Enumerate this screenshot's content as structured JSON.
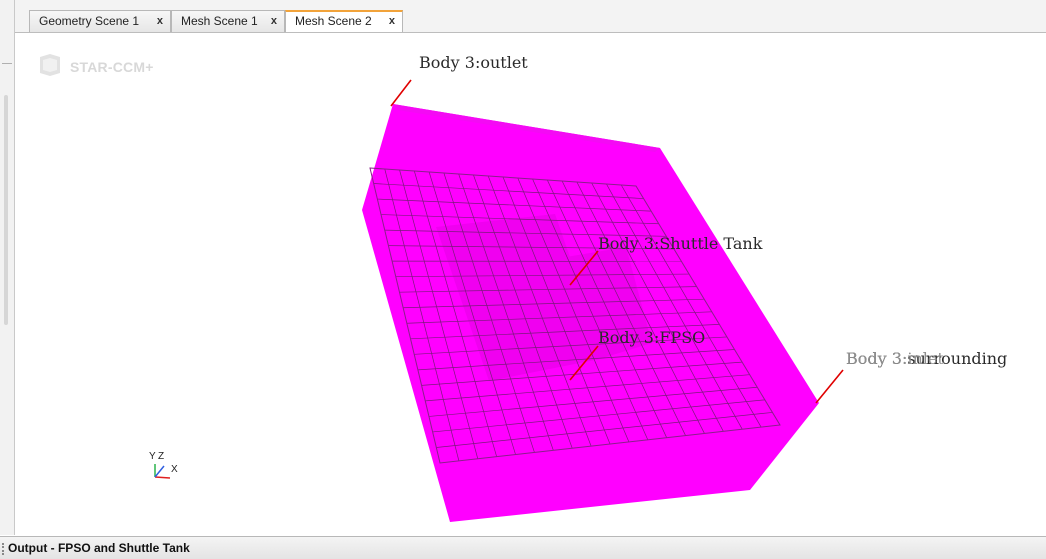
{
  "tabs": [
    {
      "label": "Geometry Scene 1",
      "close": "x",
      "active": false
    },
    {
      "label": "Mesh Scene 1",
      "close": "x",
      "active": false
    },
    {
      "label": "Mesh Scene 2",
      "close": "x",
      "active": true
    }
  ],
  "logo": {
    "text": "STAR-CCM+"
  },
  "scene": {
    "body_color": "#ff00ff",
    "mesh_color": "#7a1a7a",
    "leader_color": "#e00000",
    "labels": {
      "outlet": "Body 3:outlet",
      "shuttle_tank": "Body 3:Shuttle Tank",
      "fpso": "Body 3:FPSO",
      "inlet": "Body 3:inlet",
      "surrounding": "Body 3:surrounding"
    }
  },
  "axes": {
    "y": "Y",
    "z": "Z",
    "x": "X"
  },
  "output": {
    "title": "Output - FPSO and Shuttle Tank"
  }
}
